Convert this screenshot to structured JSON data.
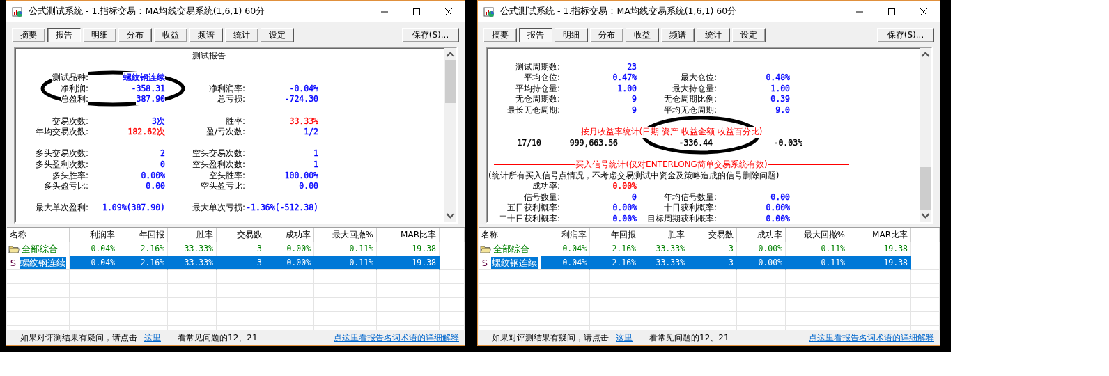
{
  "windows": [
    {
      "title": "公式测试系统 - 1.指标交易：MA均线交易系统(1,6,1) 60分",
      "tabs": [
        {
          "label": "摘要",
          "selected": false
        },
        {
          "label": "报告",
          "selected": true
        },
        {
          "label": "明细",
          "selected": false
        },
        {
          "label": "分布",
          "selected": false
        },
        {
          "label": "收益",
          "selected": false
        },
        {
          "label": "频谱",
          "selected": false
        },
        {
          "label": "统计",
          "selected": false
        },
        {
          "label": "设定",
          "selected": false
        }
      ],
      "save_button": "保存(S)...",
      "report": [
        {
          "kind": "title",
          "text": "测试报告"
        },
        {
          "kind": "blank"
        },
        {
          "kind": "pairs",
          "items": [
            {
              "label": "测试品种:",
              "value": "螺纹钢连续",
              "color": "#0000ff"
            }
          ]
        },
        {
          "kind": "pairs",
          "items": [
            {
              "label": "净利润:",
              "value": "-358.31",
              "color": "#0000ff"
            },
            {
              "label": "净利润率:",
              "value": "-0.04%",
              "color": "#0000ff"
            }
          ]
        },
        {
          "kind": "pairs",
          "items": [
            {
              "label": "总盈利:",
              "value": "387.90",
              "color": "#0000ff"
            },
            {
              "label": "总亏损:",
              "value": "-724.30",
              "color": "#0000ff"
            }
          ]
        },
        {
          "kind": "blank"
        },
        {
          "kind": "pairs",
          "items": [
            {
              "label": "交易次数:",
              "value": "3次",
              "color": "#0000ff"
            },
            {
              "label": "胜率:",
              "value": "33.33%",
              "color": "#ff0000"
            }
          ]
        },
        {
          "kind": "pairs",
          "items": [
            {
              "label": "年均交易次数:",
              "value": "182.62次",
              "color": "#ff0000"
            },
            {
              "label": "盈/亏次数:",
              "value": "1/2",
              "color": "#0000ff"
            }
          ]
        },
        {
          "kind": "blank"
        },
        {
          "kind": "pairs",
          "items": [
            {
              "label": "多头交易次数:",
              "value": "2",
              "color": "#0000ff"
            },
            {
              "label": "空头交易次数:",
              "value": "1",
              "color": "#0000ff"
            }
          ]
        },
        {
          "kind": "pairs",
          "items": [
            {
              "label": "多头盈利次数:",
              "value": "0",
              "color": "#0000ff"
            },
            {
              "label": "空头盈利次数:",
              "value": "1",
              "color": "#0000ff"
            }
          ]
        },
        {
          "kind": "pairs",
          "items": [
            {
              "label": "多头胜率:",
              "value": "0.00%",
              "color": "#0000ff"
            },
            {
              "label": "空头胜率:",
              "value": "100.00%",
              "color": "#0000ff"
            }
          ]
        },
        {
          "kind": "pairs",
          "items": [
            {
              "label": "多头盈亏比:",
              "value": "0.00",
              "color": "#0000ff"
            },
            {
              "label": "空头盈亏比:",
              "value": "0.00",
              "color": "#0000ff"
            }
          ]
        },
        {
          "kind": "blank"
        },
        {
          "kind": "pairs",
          "items": [
            {
              "label": "最大单次盈利:",
              "value": "1.09%(387.90)",
              "color": "#0000ff"
            },
            {
              "label": "最大单次亏损:",
              "value": "-1.36%(-512.38)",
              "color": "#0000ff"
            }
          ]
        }
      ],
      "columns": [
        "名称",
        "利润率",
        "年回报",
        "胜率",
        "交易数",
        "成功率",
        "最大回撤%",
        "MAR比率"
      ],
      "rows": [
        {
          "kind": "group",
          "selected": false,
          "cells": [
            "全部综合",
            "-0.04%",
            "-2.16%",
            "33.33%",
            "3",
            "0.00%",
            "0.11%",
            "-19.38"
          ]
        },
        {
          "kind": "item",
          "marker": "S",
          "selected": true,
          "cells": [
            "螺纹钢连续",
            "-0.04%",
            "-2.16%",
            "33.33%",
            "3",
            "0.00%",
            "0.11%",
            "-19.38"
          ]
        }
      ],
      "footer": {
        "question": "如果对评测结果有疑问，请点击",
        "link": "这里",
        "faq": "看常见问题的12、21",
        "glossary_link": "点这里看报告名词术语的详细解释"
      }
    },
    {
      "title": "公式测试系统 - 1.指标交易：MA均线交易系统(1,6,1) 60分",
      "tabs": [
        {
          "label": "摘要",
          "selected": false
        },
        {
          "label": "报告",
          "selected": true
        },
        {
          "label": "明细",
          "selected": false
        },
        {
          "label": "分布",
          "selected": false
        },
        {
          "label": "收益",
          "selected": false
        },
        {
          "label": "频谱",
          "selected": false
        },
        {
          "label": "统计",
          "selected": false
        },
        {
          "label": "设定",
          "selected": false
        }
      ],
      "save_button": "保存(S)...",
      "report": [
        {
          "kind": "blank"
        },
        {
          "kind": "pairs",
          "items": [
            {
              "label": "测试周期数:",
              "value": "23",
              "color": "#0000ff"
            }
          ]
        },
        {
          "kind": "pairs",
          "items": [
            {
              "label": "平均仓位:",
              "value": "0.47%",
              "color": "#0000ff"
            },
            {
              "label": "最大仓位:",
              "value": "0.48%",
              "color": "#0000ff"
            }
          ]
        },
        {
          "kind": "pairs",
          "items": [
            {
              "label": "平均持仓量:",
              "value": "1.00",
              "color": "#0000ff"
            },
            {
              "label": "最大持仓量:",
              "value": "1.00",
              "color": "#0000ff"
            }
          ]
        },
        {
          "kind": "pairs",
          "items": [
            {
              "label": "无仓周期数:",
              "value": "9",
              "color": "#0000ff"
            },
            {
              "label": "无仓周期比例:",
              "value": "0.39",
              "color": "#0000ff"
            }
          ]
        },
        {
          "kind": "pairs",
          "items": [
            {
              "label": "最长无仓周期:",
              "value": "9",
              "color": "#0000ff"
            },
            {
              "label": "平均无仓周期:",
              "value": "9.0",
              "color": "#0000ff"
            }
          ]
        },
        {
          "kind": "blank"
        },
        {
          "kind": "divider",
          "text": "按月收益率统计(日期 资产 收益金额 收益百分比)"
        },
        {
          "kind": "month",
          "cells": [
            "17/10",
            "999,663.56",
            "-336.44",
            "-0.03%"
          ]
        },
        {
          "kind": "blank"
        },
        {
          "kind": "divider",
          "text": "买入信号统计(仅对ENTERLONG简单交易系统有效)"
        },
        {
          "kind": "note",
          "text": "(统计所有买入信号点情况，不考虑交易测试中资金及策略造成的信号删除问题)"
        },
        {
          "kind": "pairs",
          "items": [
            {
              "label": "成功率:",
              "value": "0.00%",
              "color": "#ff0000"
            }
          ]
        },
        {
          "kind": "pairs",
          "items": [
            {
              "label": "信号数量:",
              "value": "0",
              "color": "#0000ff"
            },
            {
              "label": "年均信号数量:",
              "value": "0.00",
              "color": "#0000ff"
            }
          ]
        },
        {
          "kind": "pairs",
          "items": [
            {
              "label": "五日获利概率:",
              "value": "0.00%",
              "color": "#0000ff"
            },
            {
              "label": "十日获利概率:",
              "value": "0.00%",
              "color": "#0000ff"
            }
          ]
        },
        {
          "kind": "pairs",
          "items": [
            {
              "label": "二十日获利概率:",
              "value": "0.00%",
              "color": "#0000ff"
            },
            {
              "label": "目标周期获利概率:",
              "value": "0.00%",
              "color": "#0000ff"
            }
          ]
        }
      ],
      "columns": [
        "名称",
        "利润率",
        "年回报",
        "胜率",
        "交易数",
        "成功率",
        "最大回撤%",
        "MAR比率"
      ],
      "rows": [
        {
          "kind": "group",
          "selected": false,
          "cells": [
            "全部综合",
            "-0.04%",
            "-2.16%",
            "33.33%",
            "3",
            "0.00%",
            "0.11%",
            "-19.38"
          ]
        },
        {
          "kind": "item",
          "marker": "S",
          "selected": true,
          "cells": [
            "螺纹钢连续",
            "-0.04%",
            "-2.16%",
            "33.33%",
            "3",
            "0.00%",
            "0.11%",
            "-19.38"
          ]
        }
      ],
      "footer": {
        "question": "如果对评测结果有疑问，请点击",
        "link": "这里",
        "faq": "看常见问题的12、21",
        "glossary_link": "点这里看报告名词术语的详细解释"
      }
    }
  ]
}
